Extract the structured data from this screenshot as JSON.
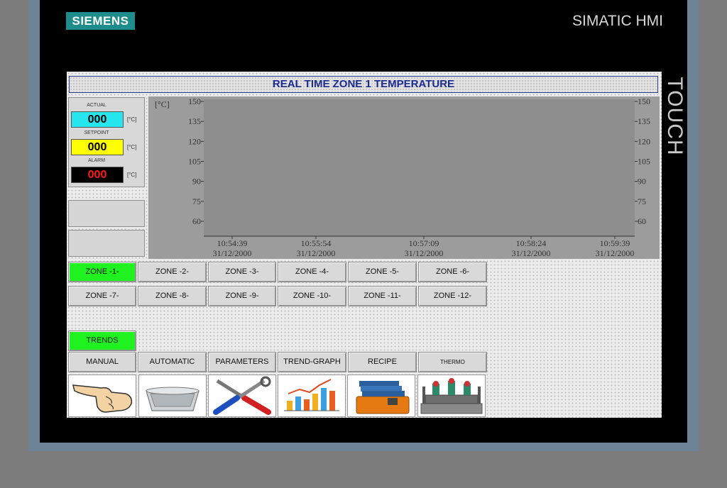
{
  "device": {
    "brand": "SIEMENS",
    "model": "SIMATIC HMI",
    "touch_label": "TOUCH"
  },
  "screen": {
    "title": "REAL  TIME  ZONE 1 TEMPERATURE",
    "gauges": [
      {
        "label": "ACTUAL",
        "value": "000",
        "unit": "[°C]",
        "bg": "#27e6f0",
        "fg": "#000000"
      },
      {
        "label": "SETPOINT",
        "value": "000",
        "unit": "[°C]",
        "bg": "#ffff00",
        "fg": "#000000"
      },
      {
        "label": "ALARM",
        "value": "000",
        "unit": "[°C]",
        "bg": "#000000",
        "fg": "#ff1a1a"
      }
    ]
  },
  "zones": {
    "row1": [
      "ZONE -1-",
      "ZONE -2-",
      "ZONE -3-",
      "ZONE -4-",
      "ZONE -5-",
      "ZONE -6-"
    ],
    "row2": [
      "ZONE -7-",
      "ZONE -8-",
      "ZONE -9-",
      "ZONE -10-",
      "ZONE -11-",
      "ZONE -12-"
    ],
    "active": "ZONE -1-"
  },
  "nav": {
    "trends": "TRENDS",
    "items": [
      "MANUAL",
      "AUTOMATIC",
      "PARAMETERS",
      "TREND-GRAPH",
      "RECIPE",
      "THERMO"
    ],
    "icons": [
      "pointing-hand-icon",
      "aluminium-tray-icon",
      "tools-icon",
      "trend-chart-icon",
      "recipe-binders-icon",
      "thermo-mold-icon"
    ]
  },
  "chart_data": {
    "type": "line",
    "ylabel": "[°C]",
    "ylim": [
      60,
      150
    ],
    "yticks": [
      150,
      135,
      120,
      105,
      90,
      75,
      60
    ],
    "xticks": [
      {
        "time": "10:54:39",
        "date": "31/12/2000"
      },
      {
        "time": "10:55:54",
        "date": "31/12/2000"
      },
      {
        "time": "10:57:09",
        "date": "31/12/2000"
      },
      {
        "time": "10:58:24",
        "date": "31/12/2000"
      },
      {
        "time": "10:59:39",
        "date": "31/12/2000"
      }
    ],
    "series": []
  }
}
